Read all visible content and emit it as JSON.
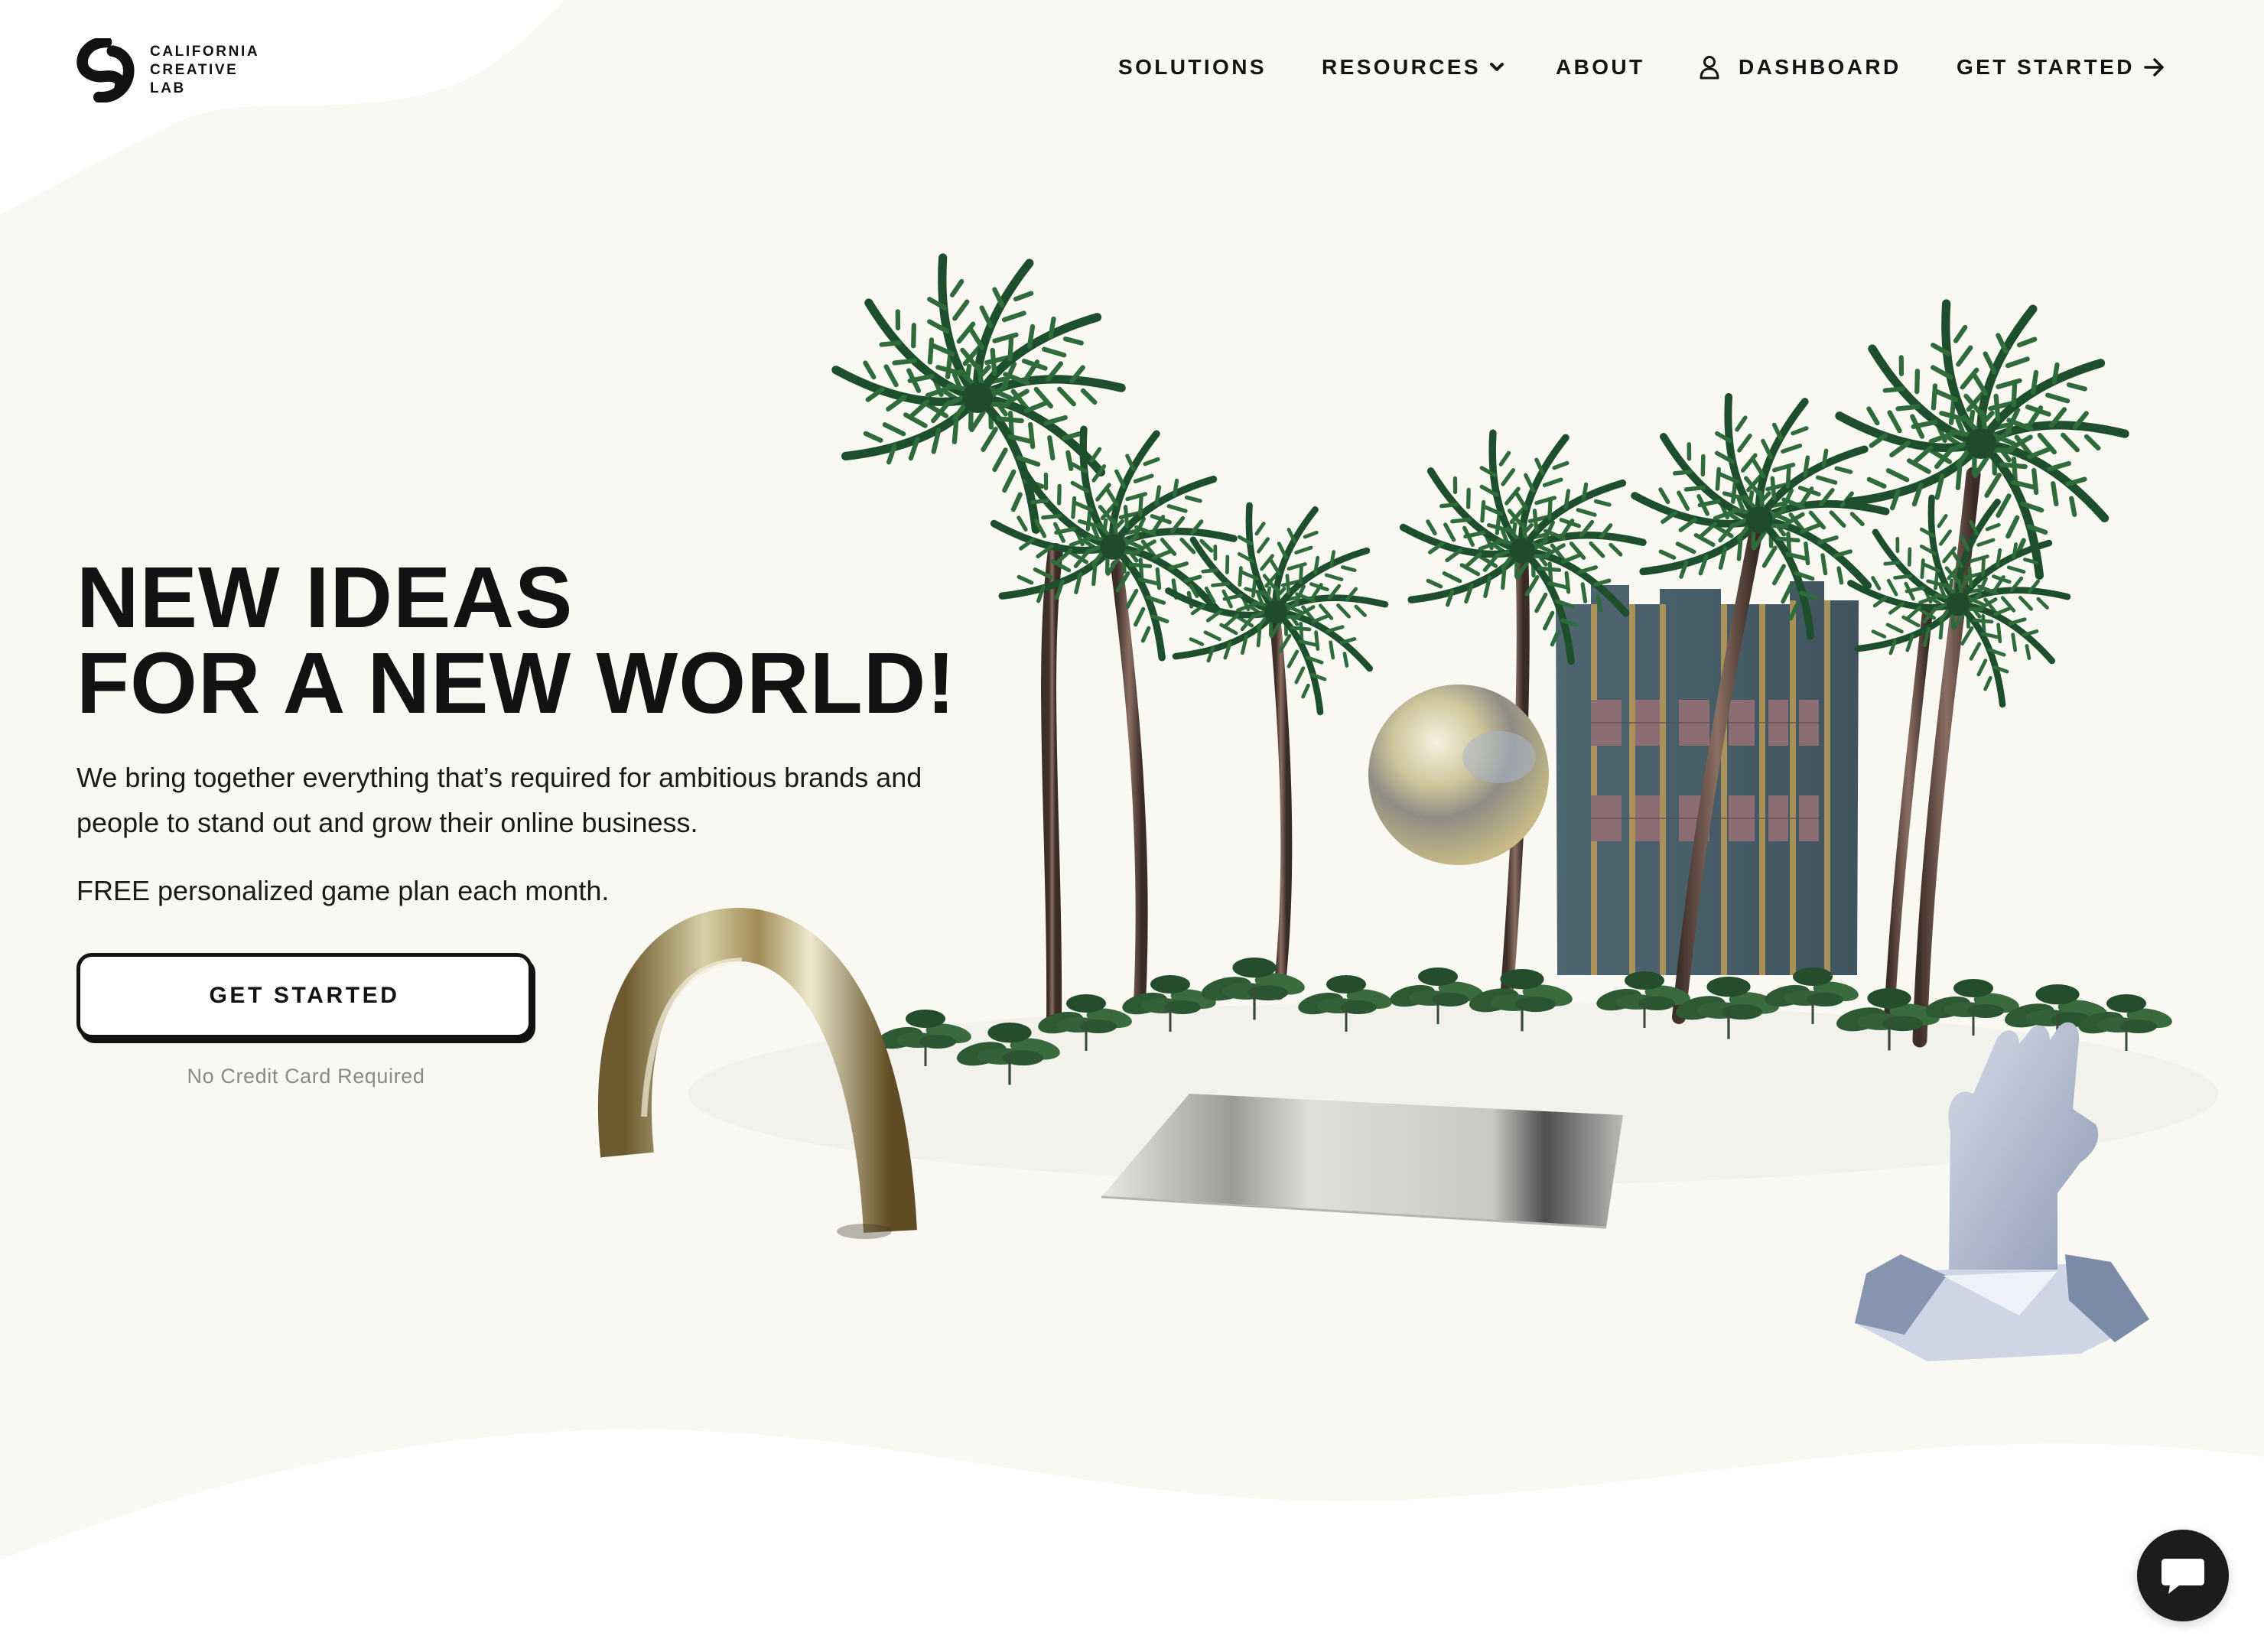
{
  "brand": {
    "line1": "CALIFORNIA",
    "line2": "CREATIVE",
    "line3": "LAB"
  },
  "nav": {
    "solutions": "SOLUTIONS",
    "resources": "RESOURCES",
    "about": "ABOUT",
    "dashboard": "DASHBOARD",
    "get_started": "GET STARTED"
  },
  "hero": {
    "title_line1": "NEW IDEAS",
    "title_line2": "FOR A NEW WORLD!",
    "description": "We bring together everything that’s required for ambitious brands and people to stand out and grow their online business.",
    "promo": "FREE personalized game plan each month.",
    "cta": "GET STARTED",
    "note": "No Credit Card Required"
  },
  "icons": {
    "logo": "swirl-logo-icon",
    "resources_dropdown": "chevron-down-icon",
    "dashboard": "user-icon",
    "get_started": "arrow-right-icon",
    "chat": "chat-bubble-icon"
  },
  "colors": {
    "background": "#faf8f2",
    "text": "#121212",
    "muted": "#8a8a8a",
    "chat_button": "#1c1c1c"
  }
}
